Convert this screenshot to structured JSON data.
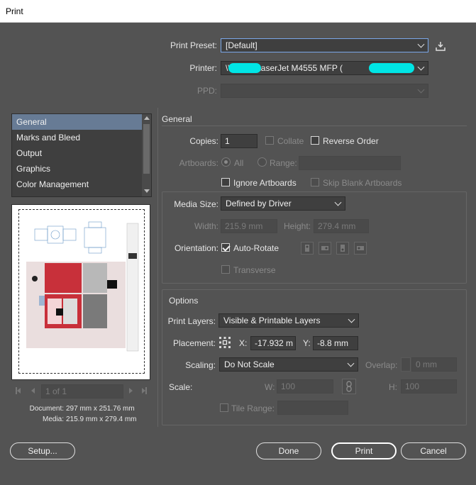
{
  "window": {
    "title": "Print"
  },
  "top": {
    "print_preset_label": "Print Preset:",
    "print_preset_value": "[Default]",
    "printer_label": "Printer:",
    "printer_value": "\\\\          nt\\HP LaserJet M4555 MFP (",
    "ppd_label": "PPD:",
    "ppd_value": ""
  },
  "categories": {
    "items": [
      "General",
      "Marks and Bleed",
      "Output",
      "Graphics",
      "Color Management"
    ],
    "selected": "General"
  },
  "navigation": {
    "page_indicator": "1 of 1"
  },
  "document_info": {
    "document_label": "Document:",
    "document_value": "297 mm x 251.76 mm",
    "media_label": "Media:",
    "media_value": "215.9 mm x 279.4 mm"
  },
  "general": {
    "heading": "General",
    "copies_label": "Copies:",
    "copies_value": "1",
    "collate_label": "Collate",
    "reverse_order_label": "Reverse Order",
    "artboards_label": "Artboards:",
    "all_label": "All",
    "range_label": "Range:",
    "range_value": "",
    "ignore_artboards_label": "Ignore Artboards",
    "skip_blank_label": "Skip Blank Artboards"
  },
  "media": {
    "media_size_label": "Media Size:",
    "media_size_value": "Defined by Driver",
    "width_label": "Width:",
    "width_value": "215.9 mm",
    "height_label": "Height:",
    "height_value": "279.4 mm",
    "orientation_label": "Orientation:",
    "auto_rotate_label": "Auto-Rotate",
    "transverse_label": "Transverse"
  },
  "options": {
    "heading": "Options",
    "print_layers_label": "Print Layers:",
    "print_layers_value": "Visible & Printable Layers",
    "placement_label": "Placement:",
    "x_label": "X:",
    "x_value": "-17.932 m",
    "y_label": "Y:",
    "y_value": "-8.8 mm",
    "scaling_label": "Scaling:",
    "scaling_value": "Do Not Scale",
    "overlap_label": "Overlap:",
    "overlap_value": "0 mm",
    "scale_label": "Scale:",
    "w_label": "W:",
    "w_value": "100",
    "h_label": "H:",
    "h_value": "100",
    "tile_range_label": "Tile Range:",
    "tile_range_value": ""
  },
  "buttons": {
    "setup": "Setup...",
    "done": "Done",
    "print": "Print",
    "cancel": "Cancel"
  },
  "colors": {
    "dialog_bg": "#535353",
    "field_bg": "#3f3f3f",
    "selection": "#677b95",
    "redaction": "#00e5e5"
  },
  "icons": [
    "save-preset-icon",
    "chevron-down-icon",
    "placement-grid-icon",
    "constrain-link-icon",
    "orientation-icon",
    "first-page-icon",
    "prev-page-icon",
    "next-page-icon",
    "last-page-icon"
  ]
}
